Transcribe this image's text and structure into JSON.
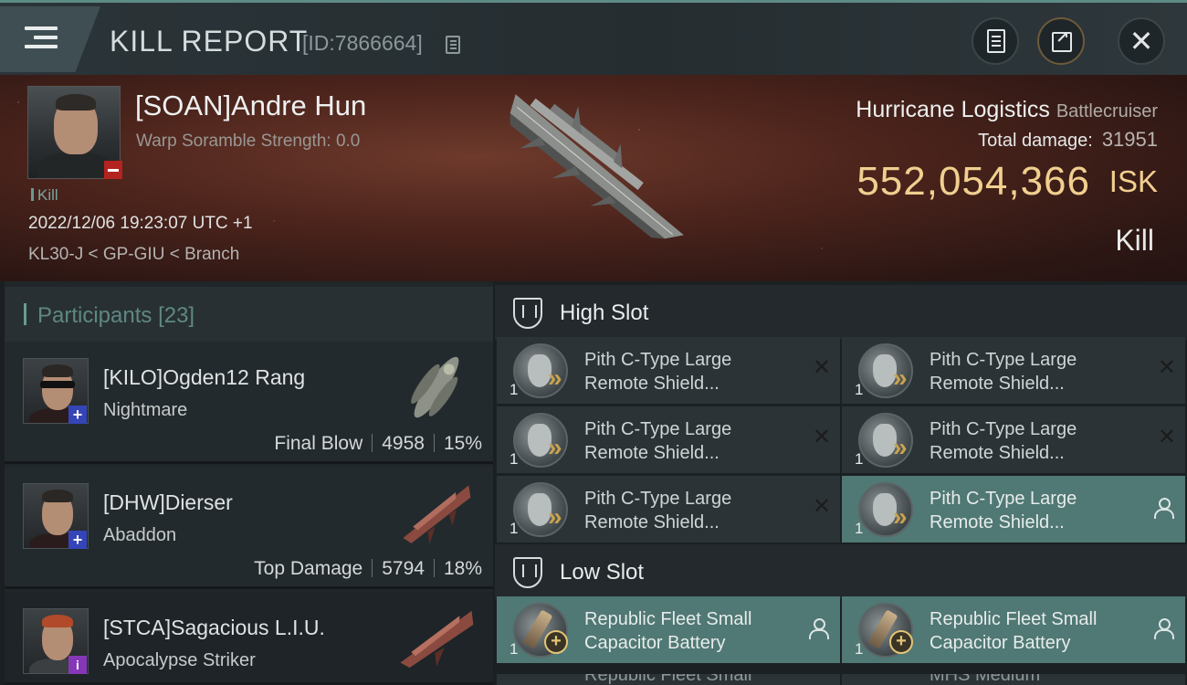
{
  "header": {
    "title": "KILL REPORT",
    "id_text": "[ID:7866664]"
  },
  "victim": {
    "name": "[SOAN]Andre Hun",
    "warp_text": "Warp Soramble Strength: 0.0",
    "kill_tag": "Kill",
    "time": "2022/12/06 19:23:07 UTC +1",
    "location": "KL30-J < GP-GIU < Branch",
    "ship_name": "Hurricane Logistics",
    "ship_class": "Battlecruiser",
    "damage_label": "Total damage:",
    "damage_value": "31951",
    "isk_value": "552,054,366",
    "isk_unit": "ISK",
    "result": "Kill"
  },
  "participants": {
    "title": "Participants",
    "count": "[23]",
    "rows": [
      {
        "name": "[KILO]Ogden12 Rang",
        "ship": "Nightmare",
        "tag": "Final Blow",
        "damage": "4958",
        "percent": "15%"
      },
      {
        "name": "[DHW]Dierser",
        "ship": "Abaddon",
        "tag": "Top Damage",
        "damage": "5794",
        "percent": "18%"
      },
      {
        "name": "[STCA]Sagacious L.I.U.",
        "ship": "Apocalypse Striker"
      }
    ]
  },
  "fittings": {
    "high_slot": {
      "title": "High Slot",
      "modules": [
        {
          "qty": "1",
          "line1": "Pith C-Type Large",
          "line2": "Remote Shield..."
        },
        {
          "qty": "1",
          "line1": "Pith C-Type Large",
          "line2": "Remote Shield..."
        },
        {
          "qty": "1",
          "line1": "Pith C-Type Large",
          "line2": "Remote Shield..."
        },
        {
          "qty": "1",
          "line1": "Pith C-Type Large",
          "line2": "Remote Shield..."
        },
        {
          "qty": "1",
          "line1": "Pith C-Type Large",
          "line2": "Remote Shield..."
        },
        {
          "qty": "1",
          "line1": "Pith C-Type Large",
          "line2": "Remote Shield..."
        }
      ]
    },
    "low_slot": {
      "title": "Low Slot",
      "modules": [
        {
          "qty": "1",
          "line1": "Republic Fleet Small",
          "line2": "Capacitor Battery"
        },
        {
          "qty": "1",
          "line1": "Republic Fleet Small",
          "line2": "Capacitor Battery"
        }
      ],
      "partial": [
        "Republic Fleet Small",
        "MHS Medium"
      ]
    },
    "close_symbol": "✕"
  },
  "colors": {
    "accent_teal": "#507874",
    "isk_gold": "#f1cf8f",
    "banner_red": "#4c241c"
  },
  "icons": [
    "menu-icon",
    "copy-icon",
    "clipboard-icon",
    "share-icon",
    "close-icon",
    "shield-module-icon",
    "capacitor-module-icon",
    "person-icon"
  ]
}
